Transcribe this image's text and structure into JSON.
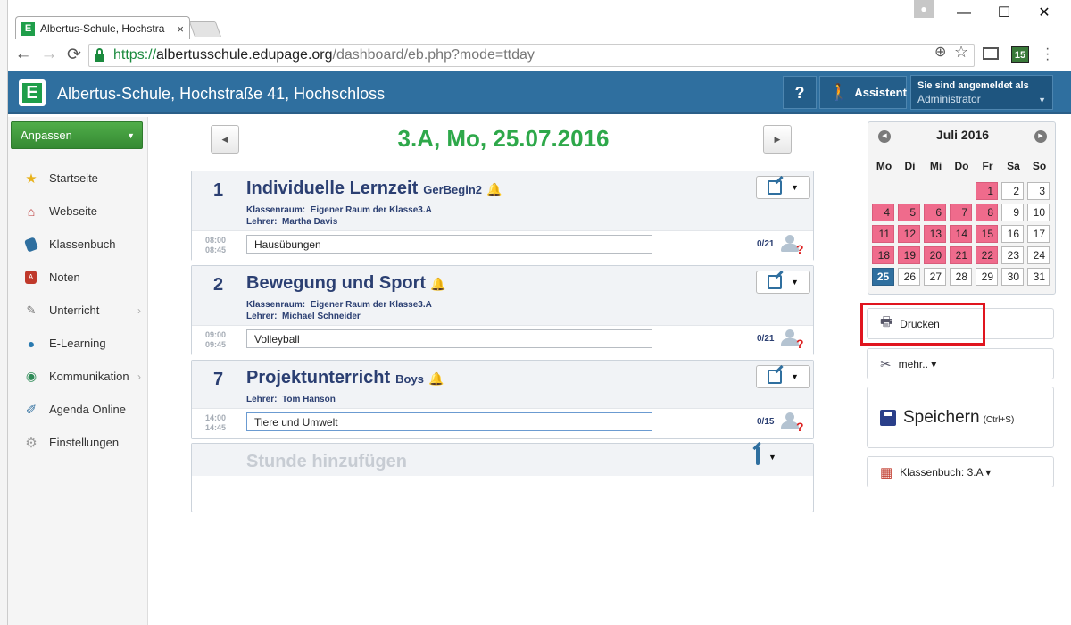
{
  "browser": {
    "tab_title": "Albertus-Schule, Hochstra",
    "tab_close": "×",
    "favicon_letter": "E",
    "url_scheme": "https://",
    "url_host": "albertusschule.edupage.org",
    "url_path": "/dashboard/eb.php?mode=ttday",
    "ext_badge": "15",
    "win_min": "—",
    "win_max": "☐",
    "win_close": "✕",
    "back": "←",
    "forward": "→",
    "reload": "⟳",
    "zoom_icon": "⊕",
    "star_icon": "☆"
  },
  "header": {
    "logo_letter": "E",
    "school": "Albertus-Schule, Hochstraße 41, Hochschloss",
    "help": "?",
    "assistant": "Assistent",
    "login_line1": "Sie sind angemeldet als",
    "login_line2": "Administrator"
  },
  "sidebar": {
    "customize": "Anpassen",
    "items": [
      {
        "label": "Startseite",
        "icon": "star-icon"
      },
      {
        "label": "Webseite",
        "icon": "house-icon"
      },
      {
        "label": "Klassenbuch",
        "icon": "book-icon"
      },
      {
        "label": "Noten",
        "icon": "grades-icon"
      },
      {
        "label": "Unterricht",
        "icon": "teaching-icon"
      },
      {
        "label": "E-Learning",
        "icon": "elearning-icon"
      },
      {
        "label": "Kommunikation",
        "icon": "communication-icon"
      },
      {
        "label": "Agenda Online",
        "icon": "pen-icon"
      },
      {
        "label": "Einstellungen",
        "icon": "settings-icon"
      }
    ]
  },
  "main": {
    "day_title": "3.A, Mo, 25.07.2016",
    "lessons": [
      {
        "num": "1",
        "subject": "Individuelle Lernzeit",
        "group": "GerBegin2",
        "room_label": "Klassenraum:",
        "room": "Eigener Raum der Klasse3.A",
        "teacher_label": "Lehrer:",
        "teacher": "Martha Davis",
        "time_from": "08:00",
        "time_to": "08:45",
        "topic": "Hausübungen",
        "count": "0/21"
      },
      {
        "num": "2",
        "subject": "Bewegung und Sport",
        "group": "",
        "room_label": "Klassenraum:",
        "room": "Eigener Raum der Klasse3.A",
        "teacher_label": "Lehrer:",
        "teacher": "Michael Schneider",
        "time_from": "09:00",
        "time_to": "09:45",
        "topic": "Volleyball",
        "count": "0/21"
      },
      {
        "num": "7",
        "subject": "Projektunterricht",
        "group": "Boys",
        "teacher_label": "Lehrer:",
        "teacher": "Tom Hanson",
        "time_from": "14:00",
        "time_to": "14:45",
        "topic": "Tiere und Umwelt",
        "count": "0/15"
      }
    ],
    "add_lesson": "Stunde hinzufügen"
  },
  "calendar": {
    "month": "Juli 2016",
    "weekdays": [
      "Mo",
      "Di",
      "Mi",
      "Do",
      "Fr",
      "Sa",
      "So"
    ],
    "days": [
      "1",
      "2",
      "3",
      "4",
      "5",
      "6",
      "7",
      "8",
      "9",
      "10",
      "11",
      "12",
      "13",
      "14",
      "15",
      "16",
      "17",
      "18",
      "19",
      "20",
      "21",
      "22",
      "23",
      "24",
      "25",
      "26",
      "27",
      "28",
      "29",
      "30",
      "31"
    ],
    "holiday_color": "#ef6b8c",
    "today": "25",
    "today_color": "#2f6f9f"
  },
  "actions": {
    "print": "Drucken",
    "more": "mehr.. ▾",
    "save": "Speichern",
    "save_shortcut": "(Ctrl+S)",
    "classbook": "Klassenbuch: 3.A ▾"
  },
  "colors": {
    "header_blue": "#2f6f9f",
    "accent_green": "#2ea84a",
    "highlight_red": "#e0151f"
  }
}
